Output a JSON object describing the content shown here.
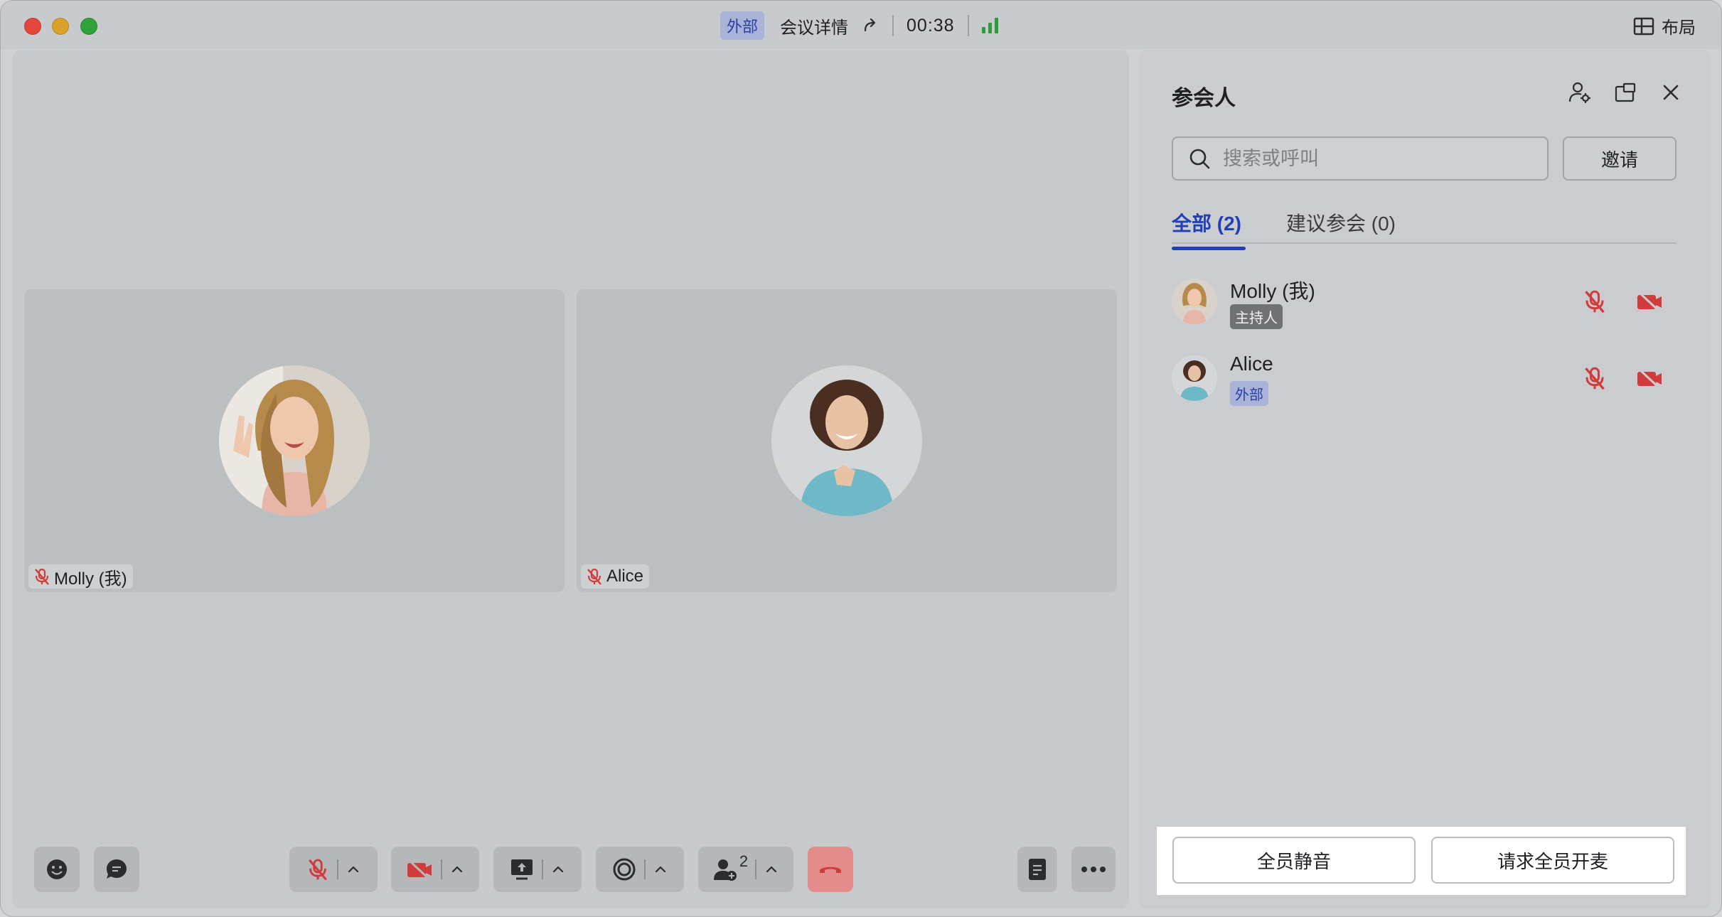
{
  "titlebar": {
    "external_badge": "外部",
    "meeting_details": "会议详情",
    "timer": "00:38",
    "layout_label": "布局"
  },
  "stage": {
    "participants": [
      {
        "name": "Molly (我)"
      },
      {
        "name": "Alice"
      }
    ]
  },
  "toolbar": {
    "share_count": "2"
  },
  "panel": {
    "title": "参会人",
    "search_placeholder": "搜索或呼叫",
    "invite_label": "邀请",
    "tabs": [
      {
        "label": "全部 (2)"
      },
      {
        "label": "建议参会 (0)"
      }
    ],
    "participants": [
      {
        "name": "Molly (我)",
        "tag": "主持人"
      },
      {
        "name": "Alice",
        "tag": "外部"
      }
    ],
    "mute_all_label": "全员静音",
    "request_unmute_label": "请求全员开麦"
  },
  "colors": {
    "accent": "#2140b8",
    "muted_red": "#d23b3b",
    "signal_green": "#2e9b3c",
    "end_call": "#e48c8c"
  }
}
